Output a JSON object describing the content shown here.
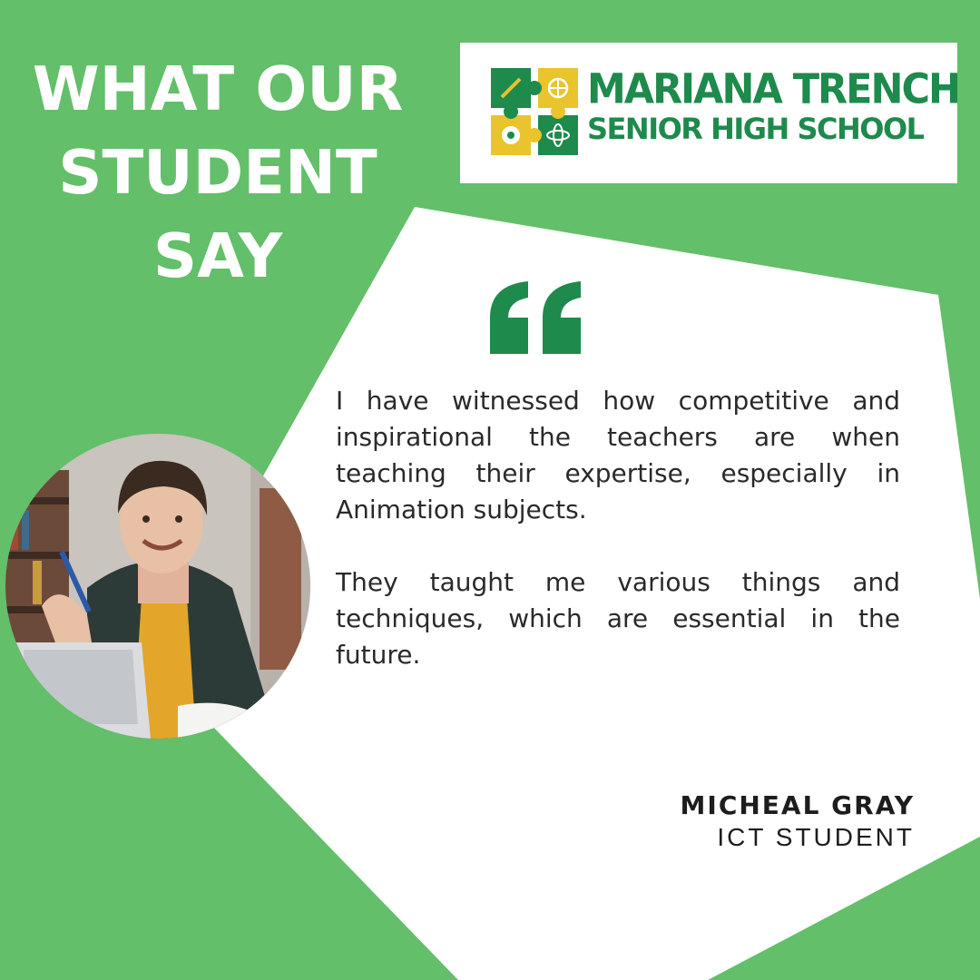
{
  "headline": {
    "line1": "WHAT OUR",
    "line2": "STUDENT",
    "line3": "SAY"
  },
  "logo": {
    "line1": "MARIANA TRENCH",
    "line2": "SENIOR HIGH SCHOOL"
  },
  "testimonial": {
    "paragraph1": "I have witnessed how competitive and inspirational the teachers are when teaching their expertise, especially in Animation subjects.",
    "paragraph2": "They taught me various things and techniques, which are essential in the future."
  },
  "author": {
    "name": "MICHEAL GRAY",
    "role": "ICT STUDENT"
  },
  "colors": {
    "background_green": "#63bf69",
    "brand_green": "#1e8a4c",
    "quote_green": "#1e8a4c",
    "puzzle_yellow": "#e9c42c",
    "panel_white": "#ffffff"
  },
  "icons": [
    "quote-mark-icon",
    "puzzle-logo-icon"
  ]
}
